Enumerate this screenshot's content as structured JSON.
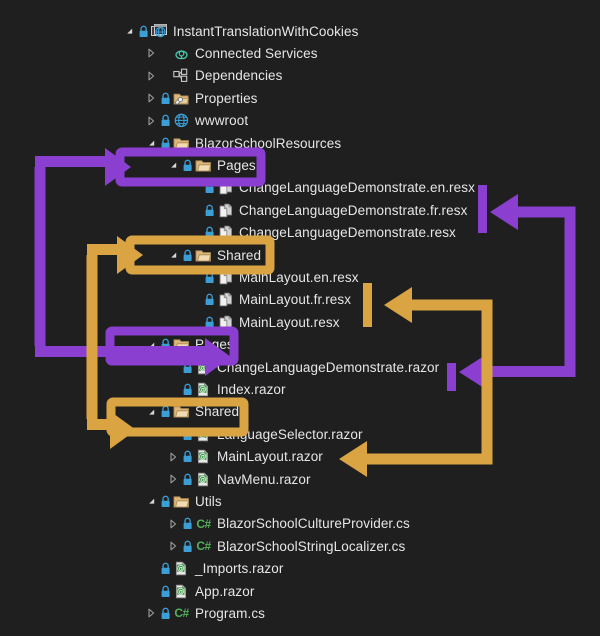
{
  "theme": {
    "background": "#1f1f1f",
    "text": "#e6e6e6",
    "folder": "#dcb67a",
    "purple": "#8a3fd1",
    "gold": "#d9a441",
    "lock_blue": "#3b9fd6",
    "csharp_green": "#53b05b",
    "razor_green": "#4a9c52"
  },
  "tree": {
    "name": "solution-explorer-tree",
    "items": [
      {
        "label": "InstantTranslationWithCookies",
        "depth": 0,
        "expander": "expanded",
        "icon": "project-web-icon",
        "lock": true
      },
      {
        "label": "Connected Services",
        "depth": 1,
        "expander": "collapsed",
        "icon": "connected-services-icon",
        "lock": false
      },
      {
        "label": "Dependencies",
        "depth": 1,
        "expander": "collapsed",
        "icon": "dependencies-icon",
        "lock": false
      },
      {
        "label": "Properties",
        "depth": 1,
        "expander": "collapsed",
        "icon": "properties-folder-icon",
        "lock": true
      },
      {
        "label": "wwwroot",
        "depth": 1,
        "expander": "collapsed",
        "icon": "wwwroot-globe-icon",
        "lock": true
      },
      {
        "label": "BlazorSchoolResources",
        "depth": 1,
        "expander": "expanded",
        "icon": "folder-icon",
        "lock": true
      },
      {
        "label": "Pages",
        "depth": 2,
        "expander": "expanded",
        "icon": "folder-icon",
        "lock": true
      },
      {
        "label": "ChangeLanguageDemonstrate.en.resx",
        "depth": 3,
        "expander": "none",
        "icon": "resx-icon",
        "lock": true
      },
      {
        "label": "ChangeLanguageDemonstrate.fr.resx",
        "depth": 3,
        "expander": "none",
        "icon": "resx-icon",
        "lock": true
      },
      {
        "label": "ChangeLanguageDemonstrate.resx",
        "depth": 3,
        "expander": "none",
        "icon": "resx-icon",
        "lock": true
      },
      {
        "label": "Shared",
        "depth": 2,
        "expander": "expanded",
        "icon": "folder-icon",
        "lock": true
      },
      {
        "label": "MainLayout.en.resx",
        "depth": 3,
        "expander": "none",
        "icon": "resx-icon",
        "lock": true
      },
      {
        "label": "MainLayout.fr.resx",
        "depth": 3,
        "expander": "none",
        "icon": "resx-icon",
        "lock": true
      },
      {
        "label": "MainLayout.resx",
        "depth": 3,
        "expander": "none",
        "icon": "resx-icon",
        "lock": true
      },
      {
        "label": "Pages",
        "depth": 1,
        "expander": "expanded",
        "icon": "folder-icon",
        "lock": true
      },
      {
        "label": "ChangeLanguageDemonstrate.razor",
        "depth": 2,
        "expander": "none",
        "icon": "razor-icon",
        "lock": true
      },
      {
        "label": "Index.razor",
        "depth": 2,
        "expander": "none",
        "icon": "razor-icon",
        "lock": true
      },
      {
        "label": "Shared",
        "depth": 1,
        "expander": "expanded",
        "icon": "folder-icon",
        "lock": true
      },
      {
        "label": "LanguageSelector.razor",
        "depth": 2,
        "expander": "none",
        "icon": "razor-icon",
        "lock": true
      },
      {
        "label": "MainLayout.razor",
        "depth": 2,
        "expander": "collapsed",
        "icon": "razor-icon",
        "lock": true
      },
      {
        "label": "NavMenu.razor",
        "depth": 2,
        "expander": "collapsed",
        "icon": "razor-icon",
        "lock": true
      },
      {
        "label": "Utils",
        "depth": 1,
        "expander": "expanded",
        "icon": "folder-icon",
        "lock": true
      },
      {
        "label": "BlazorSchoolCultureProvider.cs",
        "depth": 2,
        "expander": "collapsed",
        "icon": "csharp-icon",
        "lock": true
      },
      {
        "label": "BlazorSchoolStringLocalizer.cs",
        "depth": 2,
        "expander": "collapsed",
        "icon": "csharp-icon",
        "lock": true
      },
      {
        "label": "_Imports.razor",
        "depth": 1,
        "expander": "none",
        "icon": "razor-icon",
        "lock": true
      },
      {
        "label": "App.razor",
        "depth": 1,
        "expander": "none",
        "icon": "razor-icon",
        "lock": true
      },
      {
        "label": "Program.cs",
        "depth": 1,
        "expander": "collapsed",
        "icon": "csharp-icon",
        "lock": true
      }
    ]
  },
  "annotations": {
    "highlight_boxes": [
      {
        "name": "highlight-resources-pages",
        "target": "Pages",
        "color": "#8a3fd1"
      },
      {
        "name": "highlight-resources-shared",
        "target": "Shared",
        "color": "#d9a441"
      },
      {
        "name": "highlight-pages-folder",
        "target": "Pages",
        "color": "#8a3fd1"
      },
      {
        "name": "highlight-shared-folder",
        "target": "Shared",
        "color": "#d9a441"
      }
    ],
    "connectors": [
      {
        "name": "connector-pages-left",
        "color": "#8a3fd1",
        "description": "links resources Pages folder to Pages folder"
      },
      {
        "name": "connector-shared-left",
        "color": "#d9a441",
        "description": "links resources Shared folder to Shared folder"
      },
      {
        "name": "connector-resx-to-razor-purple",
        "color": "#8a3fd1",
        "description": "links ChangeLanguageDemonstrate resx files to ChangeLanguageDemonstrate.razor"
      },
      {
        "name": "connector-resx-to-razor-gold",
        "color": "#d9a441",
        "description": "links MainLayout resx files to MainLayout.razor"
      }
    ]
  }
}
